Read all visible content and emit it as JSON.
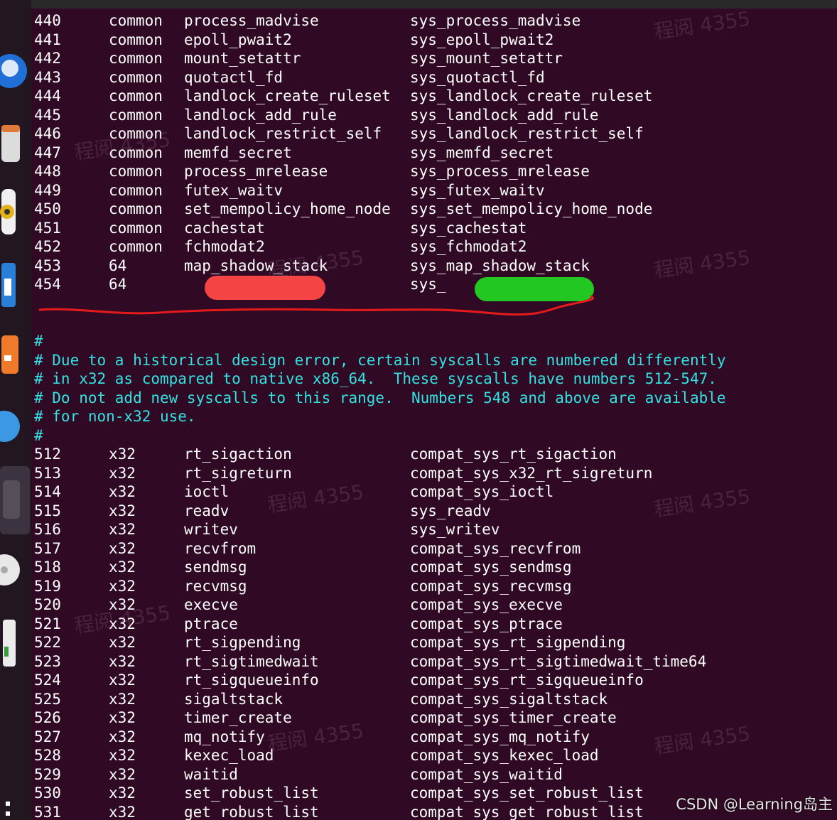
{
  "terminal": {
    "rows_top": [
      {
        "num": "440",
        "abi": "common",
        "name": "process_madvise",
        "entry": "sys_process_madvise"
      },
      {
        "num": "441",
        "abi": "common",
        "name": "epoll_pwait2",
        "entry": "sys_epoll_pwait2"
      },
      {
        "num": "442",
        "abi": "common",
        "name": "mount_setattr",
        "entry": "sys_mount_setattr"
      },
      {
        "num": "443",
        "abi": "common",
        "name": "quotactl_fd",
        "entry": "sys_quotactl_fd"
      },
      {
        "num": "444",
        "abi": "common",
        "name": "landlock_create_ruleset",
        "entry": "sys_landlock_create_ruleset"
      },
      {
        "num": "445",
        "abi": "common",
        "name": "landlock_add_rule",
        "entry": "sys_landlock_add_rule"
      },
      {
        "num": "446",
        "abi": "common",
        "name": "landlock_restrict_self",
        "entry": "sys_landlock_restrict_self"
      },
      {
        "num": "447",
        "abi": "common",
        "name": "memfd_secret",
        "entry": "sys_memfd_secret"
      },
      {
        "num": "448",
        "abi": "common",
        "name": "process_mrelease",
        "entry": "sys_process_mrelease"
      },
      {
        "num": "449",
        "abi": "common",
        "name": "futex_waitv",
        "entry": "sys_futex_waitv"
      },
      {
        "num": "450",
        "abi": "common",
        "name": "set_mempolicy_home_node",
        "entry": "sys_set_mempolicy_home_node"
      },
      {
        "num": "451",
        "abi": "common",
        "name": "cachestat",
        "entry": "sys_cachestat"
      },
      {
        "num": "452",
        "abi": "common",
        "name": "fchmodat2",
        "entry": "sys_fchmodat2"
      },
      {
        "num": "453",
        "abi": "64",
        "name": "map_shadow_stack",
        "entry": "sys_map_shadow_stack"
      },
      {
        "num": "454",
        "abi": "64",
        "name": "",
        "entry": "sys_"
      }
    ],
    "comments": [
      "#",
      "# Due to a historical design error, certain syscalls are numbered differently",
      "# in x32 as compared to native x86_64.  These syscalls have numbers 512-547.",
      "# Do not add new syscalls to this range.  Numbers 548 and above are available",
      "# for non-x32 use.",
      "#"
    ],
    "rows_bottom": [
      {
        "num": "512",
        "abi": "x32",
        "name": "rt_sigaction",
        "entry": "compat_sys_rt_sigaction"
      },
      {
        "num": "513",
        "abi": "x32",
        "name": "rt_sigreturn",
        "entry": "compat_sys_x32_rt_sigreturn"
      },
      {
        "num": "514",
        "abi": "x32",
        "name": "ioctl",
        "entry": "compat_sys_ioctl"
      },
      {
        "num": "515",
        "abi": "x32",
        "name": "readv",
        "entry": "sys_readv"
      },
      {
        "num": "516",
        "abi": "x32",
        "name": "writev",
        "entry": "sys_writev"
      },
      {
        "num": "517",
        "abi": "x32",
        "name": "recvfrom",
        "entry": "compat_sys_recvfrom"
      },
      {
        "num": "518",
        "abi": "x32",
        "name": "sendmsg",
        "entry": "compat_sys_sendmsg"
      },
      {
        "num": "519",
        "abi": "x32",
        "name": "recvmsg",
        "entry": "compat_sys_recvmsg"
      },
      {
        "num": "520",
        "abi": "x32",
        "name": "execve",
        "entry": "compat_sys_execve"
      },
      {
        "num": "521",
        "abi": "x32",
        "name": "ptrace",
        "entry": "compat_sys_ptrace"
      },
      {
        "num": "522",
        "abi": "x32",
        "name": "rt_sigpending",
        "entry": "compat_sys_rt_sigpending"
      },
      {
        "num": "523",
        "abi": "x32",
        "name": "rt_sigtimedwait",
        "entry": "compat_sys_rt_sigtimedwait_time64"
      },
      {
        "num": "524",
        "abi": "x32",
        "name": "rt_sigqueueinfo",
        "entry": "compat_sys_rt_sigqueueinfo"
      },
      {
        "num": "525",
        "abi": "x32",
        "name": "sigaltstack",
        "entry": "compat_sys_sigaltstack"
      },
      {
        "num": "526",
        "abi": "x32",
        "name": "timer_create",
        "entry": "compat_sys_timer_create"
      },
      {
        "num": "527",
        "abi": "x32",
        "name": "mq_notify",
        "entry": "compat_sys_mq_notify"
      },
      {
        "num": "528",
        "abi": "x32",
        "name": "kexec_load",
        "entry": "compat_sys_kexec_load"
      },
      {
        "num": "529",
        "abi": "x32",
        "name": "waitid",
        "entry": "compat_sys_waitid"
      },
      {
        "num": "530",
        "abi": "x32",
        "name": "set_robust_list",
        "entry": "compat_sys_set_robust_list"
      },
      {
        "num": "531",
        "abi": "x32",
        "name": "get_robust_list",
        "entry": "compat_sys_get_robust_list"
      }
    ]
  },
  "watermark": {
    "tile_text": "程阅 4355",
    "credit": "CSDN @Learning岛主"
  },
  "colors": {
    "terminal_bg": "#300a24",
    "text": "#ffffff",
    "comment": "#34e2e2",
    "redact_red": "#f44444",
    "redact_green": "#22c722",
    "underline_red": "#e51b1b"
  },
  "dock": {
    "icons": [
      "firefox-icon",
      "files-icon",
      "rhythmbox-icon",
      "writer-icon",
      "software-icon",
      "help-icon",
      "app-icon",
      "disk-icon",
      "trash-icon",
      "app-grid-icon"
    ]
  }
}
